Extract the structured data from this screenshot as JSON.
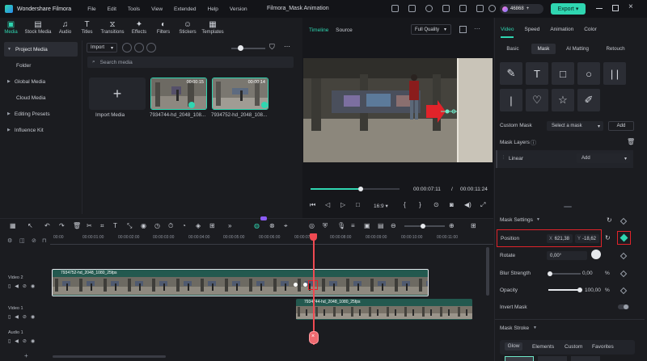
{
  "app": {
    "name": "Wondershare Filmora",
    "window_title": "Filmora_Mask Animation",
    "credits": "46868",
    "export_label": "Export"
  },
  "menu": [
    "File",
    "Edit",
    "Tools",
    "View",
    "Extended",
    "Help",
    "Version"
  ],
  "media_tabs": [
    {
      "label": "Media",
      "icon": "media-icon"
    },
    {
      "label": "Stock Media",
      "icon": "stock-media-icon"
    },
    {
      "label": "Audio",
      "icon": "audio-icon"
    },
    {
      "label": "Titles",
      "icon": "titles-icon"
    },
    {
      "label": "Transitions",
      "icon": "transitions-icon"
    },
    {
      "label": "Effects",
      "icon": "effects-icon"
    },
    {
      "label": "Filters",
      "icon": "filters-icon"
    },
    {
      "label": "Stickers",
      "icon": "stickers-icon"
    },
    {
      "label": "Templates",
      "icon": "templates-icon"
    }
  ],
  "sidebar": [
    {
      "label": "Project Media"
    },
    {
      "label": "Folder"
    },
    {
      "label": "Global Media"
    },
    {
      "label": "Cloud Media"
    },
    {
      "label": "Editing Presets"
    },
    {
      "label": "Influence Kit"
    }
  ],
  "media": {
    "import_label": "Import",
    "search_placeholder": "Search media",
    "import_media_label": "Import Media",
    "items": [
      {
        "name": "7934744-hd_2048_108...",
        "duration": "00:00:15"
      },
      {
        "name": "7934752-hd_2048_108...",
        "duration": "00:00:14"
      }
    ]
  },
  "player": {
    "tab_timeline": "Timeline",
    "tab_source": "Source",
    "quality": "Full Quality",
    "current_time": "00:00:07:11",
    "separator": "/",
    "total_time": "00:00:11:24",
    "aspect": "16:9",
    "progress": 0.55
  },
  "right": {
    "tabs": [
      "Video",
      "Speed",
      "Animation",
      "Color"
    ],
    "subtabs": [
      "Basic",
      "Mask",
      "AI Matting",
      "Retouch"
    ],
    "custom_mask_label": "Custom Mask",
    "select_mask": "Select a mask",
    "add_label": "Add",
    "mask_layers_label": "Mask Layers",
    "layer_name": "Linear",
    "layer_blend": "Add",
    "mask_settings_label": "Mask Settings",
    "position_label": "Position",
    "pos_x_label": "X",
    "pos_x": "621,38",
    "pos_y_label": "Y",
    "pos_y": "-18,62",
    "rotate_label": "Rotate",
    "rotate_value": "0,00°",
    "blur_label": "Blur Strength",
    "blur_value": "0,00",
    "blur_unit": "%",
    "opacity_label": "Opacity",
    "opacity_value": "100,00",
    "opacity_unit": "%",
    "invert_label": "Invert Mask",
    "stroke_label": "Mask Stroke",
    "stroke_tabs": [
      "Glow",
      "Elements",
      "Custom",
      "Favorites"
    ]
  },
  "timeline": {
    "ruler": [
      "00:00",
      "00:00:01:00",
      "00:00:02:00",
      "00:00:03:00",
      "00:00:04:00",
      "00:00:05:00",
      "00:00:06:00",
      "00:00:07:00",
      "00:00:08:00",
      "00:00:09:00",
      "00:00:10:00",
      "00:00:11:00"
    ],
    "tracks": [
      {
        "label": "Video 2"
      },
      {
        "label": "Video 1"
      },
      {
        "label": "Audio 1"
      }
    ],
    "clip1": "7934752-hd_2048_1080_25fps",
    "clip2": "7934744-hd_2048_1080_25fps"
  },
  "colors": {
    "accent": "#2fd6b1",
    "highlight": "#e1232a",
    "playhead": "#ef4a52"
  }
}
